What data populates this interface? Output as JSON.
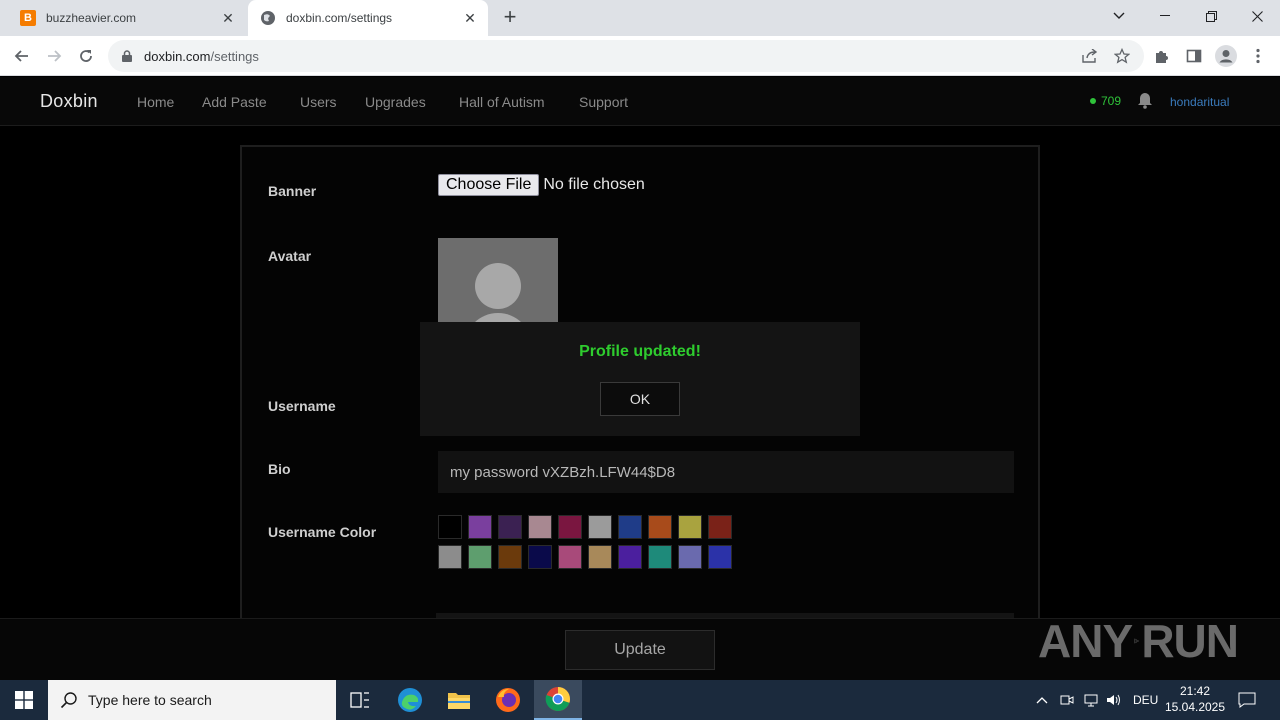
{
  "browser": {
    "tabs": [
      {
        "title": "buzzheavier.com",
        "favicon": "B"
      },
      {
        "title": "doxbin.com/settings",
        "active": true
      }
    ],
    "url_host": "doxbin.com",
    "url_path": "/settings"
  },
  "site": {
    "brand": "Doxbin",
    "nav": [
      "Home",
      "Add Paste",
      "Users",
      "Upgrades",
      "Hall of Autism",
      "Support"
    ],
    "coins": "709",
    "username": "hondaritual"
  },
  "settings": {
    "banner_label": "Banner",
    "choose_file": "Choose File",
    "file_status": "No file chosen",
    "avatar_label": "Avatar",
    "username_label": "Username",
    "bio_label": "Bio",
    "bio_value": "my password vXZBzh.LFW44$D8",
    "color_label": "Username Color",
    "colors_row1": [
      "#000000",
      "#7a3f9e",
      "#3b2152",
      "#a88891",
      "#7a1640",
      "#9b9b9b",
      "#1f3c88",
      "#a84b1b",
      "#a9a33f",
      "#7a2218"
    ],
    "colors_row2": [
      "#8c8c8c",
      "#5e9e6e",
      "#6b3a0c",
      "#0a0a4a",
      "#a84a7a",
      "#a8895a",
      "#4b1f9e",
      "#1e8a7a",
      "#6a6aae",
      "#2b32a8"
    ],
    "update_label": "Update"
  },
  "modal": {
    "message": "Profile updated!",
    "ok_label": "OK"
  },
  "watermark": "ANY RUN",
  "taskbar": {
    "search_placeholder": "Type here to search",
    "language": "DEU",
    "time": "21:42",
    "date": "15.04.2025"
  }
}
